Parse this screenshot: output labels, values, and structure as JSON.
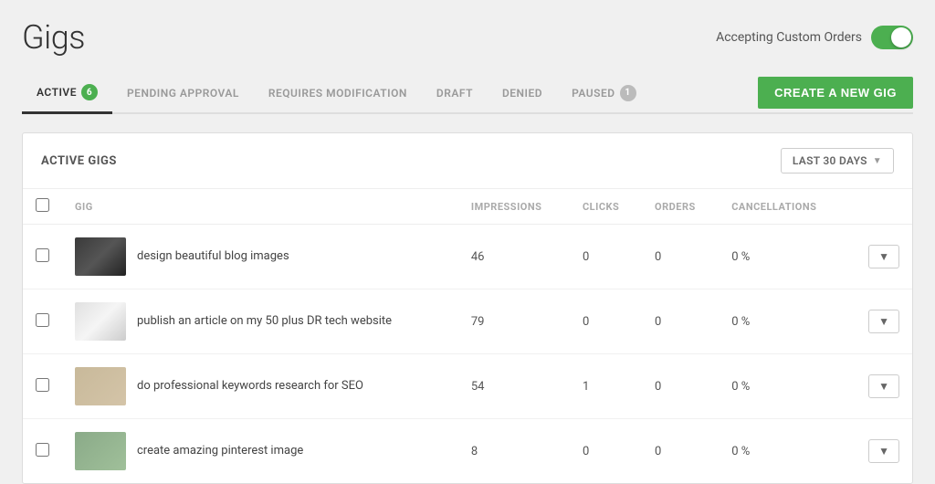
{
  "page": {
    "title": "Gigs"
  },
  "header": {
    "custom_orders_label": "Accepting Custom Orders",
    "toggle_on": true
  },
  "tabs": [
    {
      "id": "active",
      "label": "ACTIVE",
      "badge": "6",
      "badge_color": "green",
      "active": true
    },
    {
      "id": "pending",
      "label": "PENDING APPROVAL",
      "badge": null,
      "active": false
    },
    {
      "id": "requires",
      "label": "REQUIRES MODIFICATION",
      "badge": null,
      "active": false
    },
    {
      "id": "draft",
      "label": "DRAFT",
      "badge": null,
      "active": false
    },
    {
      "id": "denied",
      "label": "DENIED",
      "badge": null,
      "active": false
    },
    {
      "id": "paused",
      "label": "PAUSED",
      "badge": "1",
      "badge_color": "gray",
      "active": false
    }
  ],
  "create_button_label": "CREATE A NEW GIG",
  "active_gigs_section": {
    "title": "ACTIVE GIGS",
    "period_label": "LAST 30 DAYS",
    "columns": [
      {
        "id": "gig",
        "label": "GIG"
      },
      {
        "id": "impressions",
        "label": "IMPRESSIONS"
      },
      {
        "id": "clicks",
        "label": "CLICKS"
      },
      {
        "id": "orders",
        "label": "ORDERS"
      },
      {
        "id": "cancellations",
        "label": "CANCELLATIONS"
      }
    ],
    "rows": [
      {
        "id": 1,
        "name": "design beautiful blog images",
        "impressions": "46",
        "clicks": "0",
        "orders": "0",
        "cancellations": "0 %",
        "thumb_class": "thumb-1"
      },
      {
        "id": 2,
        "name": "publish an article on my 50 plus DR tech website",
        "impressions": "79",
        "clicks": "0",
        "orders": "0",
        "cancellations": "0 %",
        "thumb_class": "thumb-2"
      },
      {
        "id": 3,
        "name": "do professional keywords research for SEO",
        "impressions": "54",
        "clicks": "1",
        "orders": "0",
        "cancellations": "0 %",
        "thumb_class": "thumb-3"
      },
      {
        "id": 4,
        "name": "create amazing pinterest image",
        "impressions": "8",
        "clicks": "0",
        "orders": "0",
        "cancellations": "0 %",
        "thumb_class": "thumb-4"
      }
    ]
  }
}
